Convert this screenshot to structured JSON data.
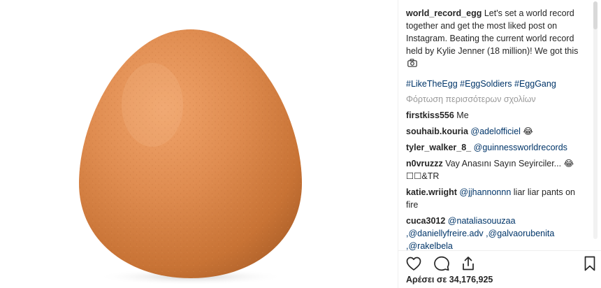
{
  "post": {
    "username": "world_record_egg",
    "caption_text": "Let's set a world record together and get the most liked post on Instagram. Beating the current world record held by Kylie Jenner (18 million)! We got this",
    "caption_emoji_icon": "camera-icon",
    "hashtags": [
      "#LikeTheEgg",
      "#EggSoldiers",
      "#EggGang"
    ],
    "load_more_comments": "Φόρτωση περισσότερων σχολίων",
    "likes_label": "Αρέσει σε 34,176,925"
  },
  "comments": [
    {
      "user": "firstkiss556",
      "pre": "Me",
      "mention": "",
      "post": ""
    },
    {
      "user": "souhaib.kouria",
      "pre": "",
      "mention": "@adelofficiel",
      "post": "😂"
    },
    {
      "user": "tyler_walker_8_",
      "pre": "",
      "mention": "@guinnessworldrecords",
      "post": ""
    },
    {
      "user": "n0vruzzz",
      "pre": "Vay Anasını Sayın Seyirciler... 😂 ☐☐&TR",
      "mention": "",
      "post": ""
    },
    {
      "user": "katie.wriight",
      "pre": "",
      "mention": "@jjhannonnn",
      "post": "liar liar pants on fire"
    },
    {
      "user": "cuca3012",
      "pre": "",
      "mention": "@nataliasouuzaa ,@daniellyfreire.adv ,@galvaorubenita ,@rakelbela",
      "post": ""
    }
  ],
  "icons": {
    "like": "heart-outline-icon",
    "comment": "comment-bubble-icon",
    "share": "share-upload-icon",
    "save": "bookmark-icon"
  },
  "colors": {
    "link": "#003569",
    "muted": "#999999",
    "text": "#262626",
    "egg": "#d98a4f"
  }
}
